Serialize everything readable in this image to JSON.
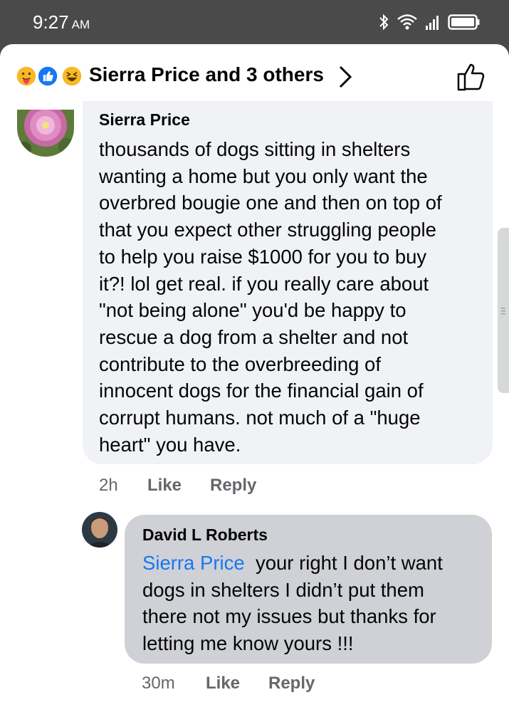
{
  "status_bar": {
    "time": "9:27",
    "ampm": "AM"
  },
  "header": {
    "title": "Sierra Price and 3 others",
    "reactions": [
      "care-reaction-icon",
      "like-reaction-icon",
      "haha-reaction-icon"
    ],
    "like_color": "#1877f2"
  },
  "comments": [
    {
      "author": "Sierra Price",
      "text_lines": [
        "thousands of dogs sitting in shelters",
        "wanting a home but you only want the",
        "overbred bougie one and then on top of",
        "that you expect other struggling people",
        "to help you raise $1000 for you to buy",
        "it?! lol get real. if you really care about",
        "\"not being alone\" you'd be happy to",
        "rescue a dog from a shelter and not",
        "contribute to the overbreeding of",
        "innocent dogs for the financial gain of",
        "corrupt humans. not much of a \"huge",
        "heart\" you have."
      ],
      "time": "2h",
      "like": "Like",
      "reply": "Reply"
    },
    {
      "author": "David L Roberts",
      "mention": "Sierra Price",
      "text_first": "your right I don’t want",
      "text_lines": [
        "dogs in shelters I didn’t put them",
        "there not my issues but thanks for",
        "letting me know yours !!!"
      ],
      "time": "30m",
      "like": "Like",
      "reply": "Reply"
    }
  ],
  "colors": {
    "bubble_1": "#f0f2f5",
    "bubble_2": "#cfd1d6",
    "mention": "#1877f2",
    "meta_text": "#65676b"
  }
}
